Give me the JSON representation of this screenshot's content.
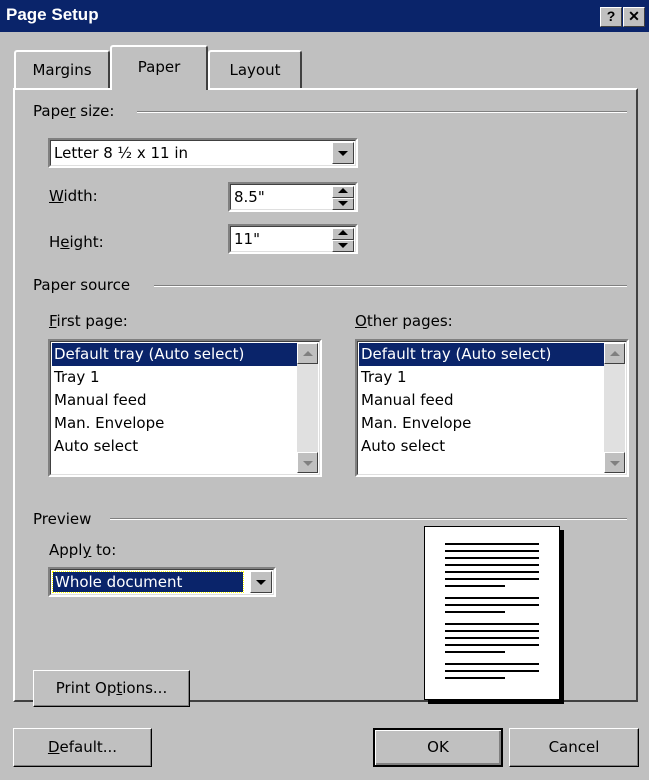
{
  "window": {
    "title": "Page Setup",
    "help_btn": "?",
    "close_btn": "✕"
  },
  "tabs": [
    {
      "label": "Margins",
      "active": false
    },
    {
      "label": "Paper",
      "active": true
    },
    {
      "label": "Layout",
      "active": false
    }
  ],
  "paper_size": {
    "group_label_pre": "Pape",
    "group_label_u": "r",
    "group_label_post": " size:",
    "selected": "Letter 8 ½ x 11 in",
    "width_label_u": "W",
    "width_label_post": "idth:",
    "width_value": "8.5\"",
    "height_label_pre": "H",
    "height_label_u": "e",
    "height_label_post": "ight:",
    "height_value": "11\""
  },
  "paper_source": {
    "group_label": "Paper source",
    "first_page_label_u": "F",
    "first_page_label_post": "irst page:",
    "other_pages_label_u": "O",
    "other_pages_label_post": "ther pages:",
    "first_page_items": [
      "Default tray (Auto select)",
      "Tray 1",
      "Manual feed",
      "Man. Envelope",
      "Auto select"
    ],
    "other_pages_items": [
      "Default tray (Auto select)",
      "Tray 1",
      "Manual feed",
      "Man. Envelope",
      "Auto select"
    ],
    "selected_index": 0
  },
  "preview": {
    "group_label": "Preview",
    "apply_to_label_pre": "Appl",
    "apply_to_label_u": "y",
    "apply_to_label_post": " to:",
    "apply_to_value": "Whole document"
  },
  "buttons": {
    "print_options_pre": "Print Op",
    "print_options_u": "t",
    "print_options_post": "ions...",
    "default_u": "D",
    "default_post": "efault...",
    "ok": "OK",
    "cancel": "Cancel"
  },
  "colors": {
    "title_bar": "#0a246a",
    "face": "#c0c0c0",
    "selection": "#0a246a"
  }
}
